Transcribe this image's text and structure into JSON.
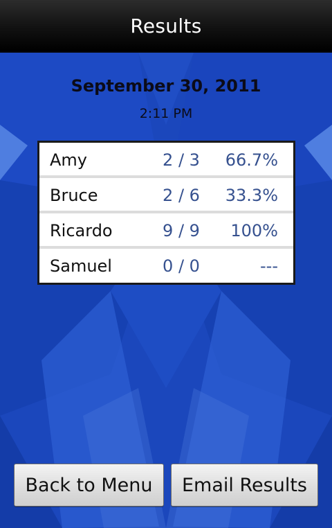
{
  "titlebar": {
    "title": "Results"
  },
  "date": "September 30, 2011",
  "time": "2:11 PM",
  "results": [
    {
      "name": "Amy",
      "score": "2 / 3",
      "percent": "66.7%"
    },
    {
      "name": "Bruce",
      "score": "2 / 6",
      "percent": "33.3%"
    },
    {
      "name": "Ricardo",
      "score": "9 / 9",
      "percent": "100%"
    },
    {
      "name": "Samuel",
      "score": "0 / 0",
      "percent": "---"
    }
  ],
  "buttons": {
    "back_label": "Back to Menu",
    "email_label": "Email Results"
  },
  "colors": {
    "background": "#1a44b8",
    "score_text": "#36518f"
  }
}
